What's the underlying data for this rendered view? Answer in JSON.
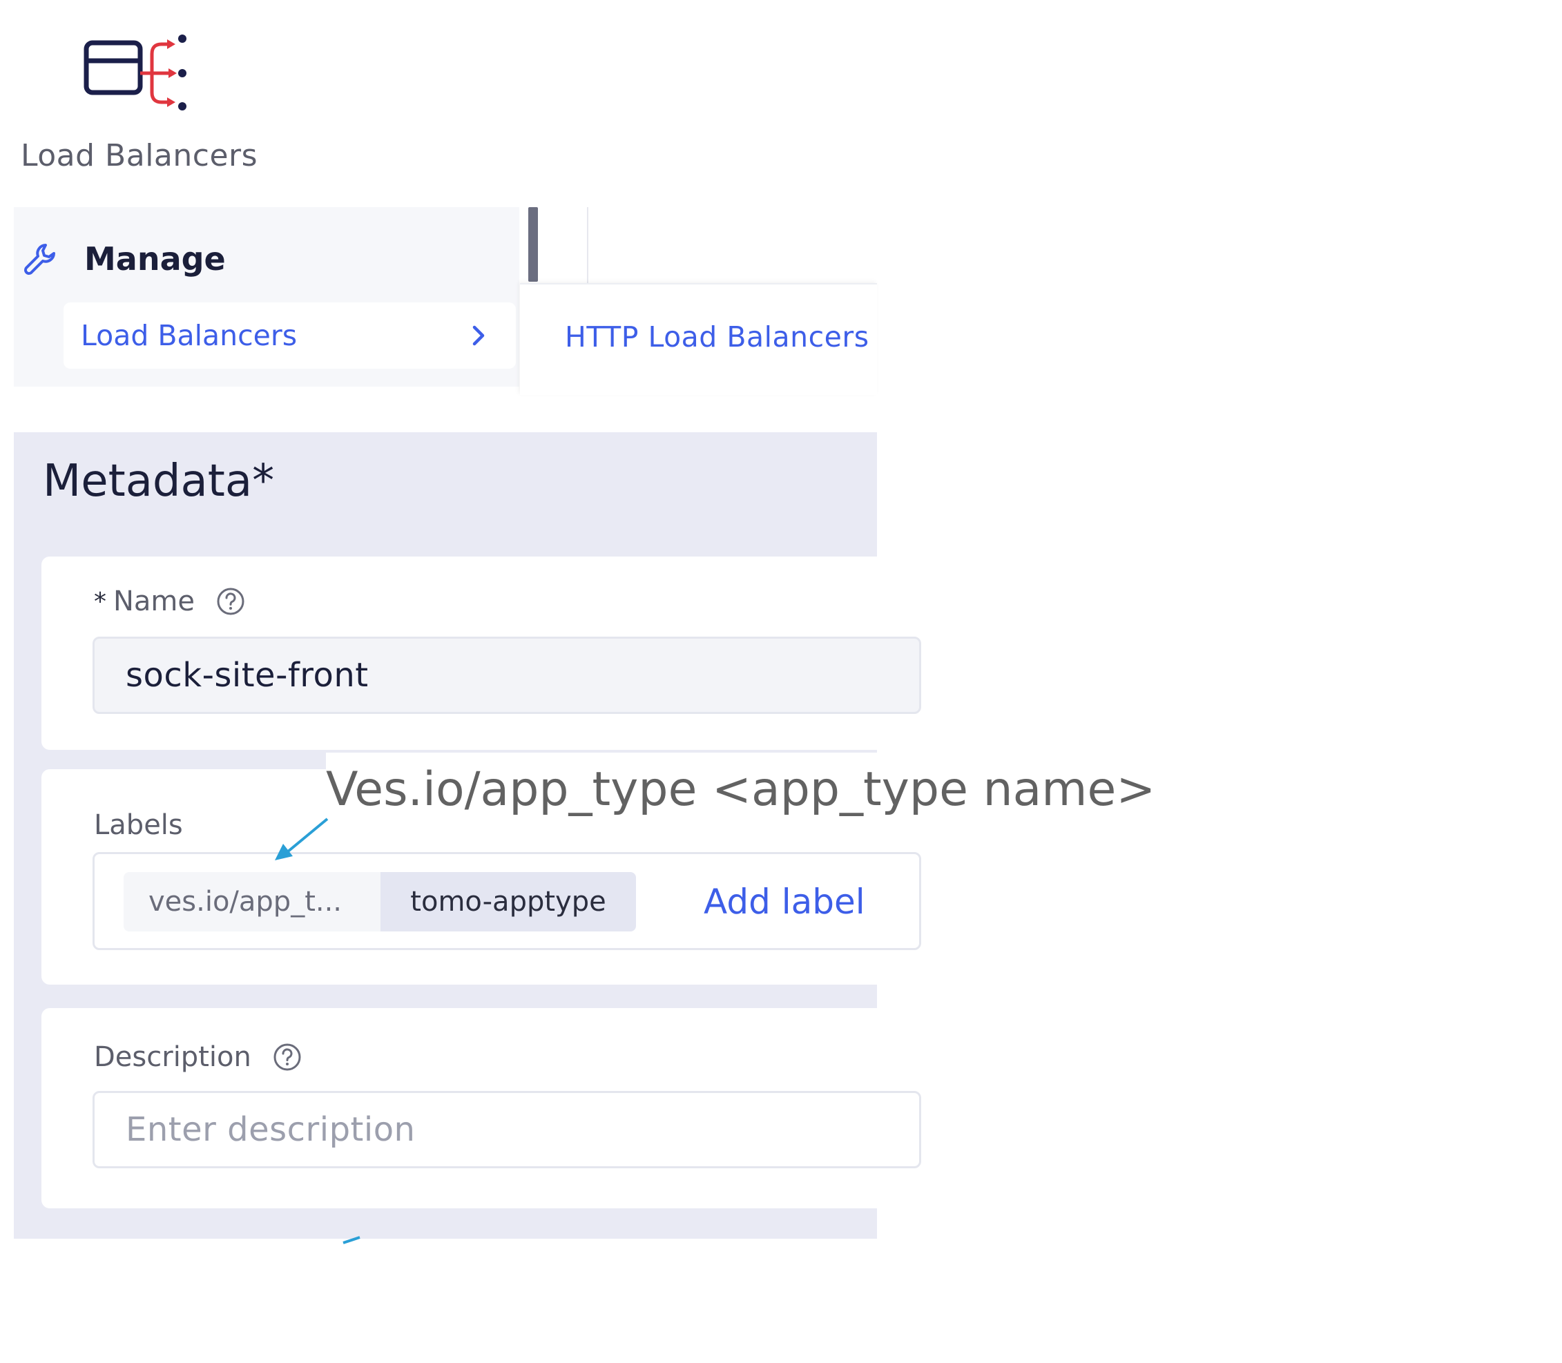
{
  "app": {
    "title": "Load Balancers",
    "icon": "load-balancer-icon"
  },
  "nav": {
    "section_label": "Manage",
    "section_icon": "wrench-icon",
    "item_label": "Load Balancers",
    "item_icon": "chevron-right-icon",
    "submenu_item": "HTTP Load Balancers"
  },
  "metadata": {
    "title": "Metadata",
    "title_required_mark": "*",
    "name": {
      "required_mark": "*",
      "label": "Name",
      "value": "sock-site-front"
    },
    "labels": {
      "label": "Labels",
      "chip_key": "ves.io/app_t...",
      "chip_value": "tomo-apptype",
      "add_label": "Add label"
    },
    "description": {
      "label": "Description",
      "placeholder": "Enter description"
    }
  },
  "annotation": {
    "text": "Ves.io/app_type <app_type name>",
    "color": "#2a9fd6"
  },
  "colors": {
    "accent": "#3d5ee8",
    "icon_red": "#e0363f",
    "icon_navy": "#1b1f4a",
    "section_bg": "#e9eaf4"
  }
}
